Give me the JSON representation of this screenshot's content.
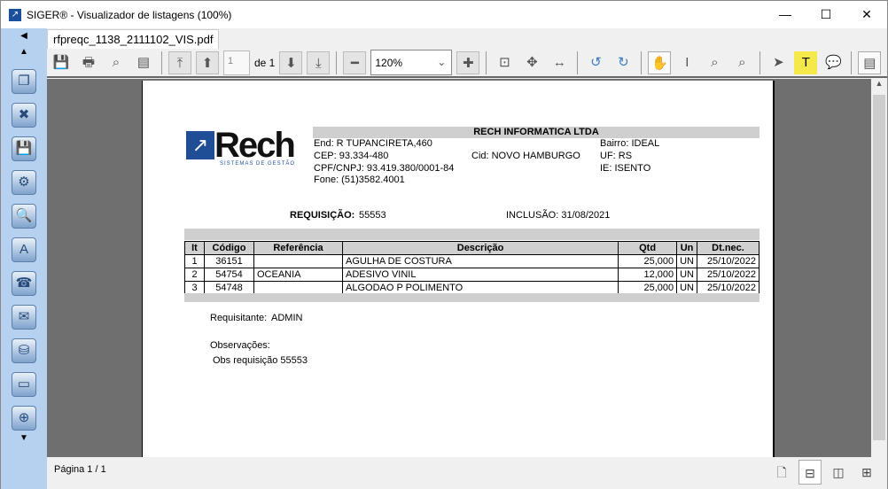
{
  "window": {
    "title": "SIGER® - Visualizador de listagens (100%)",
    "controls": [
      "minimize",
      "maximize",
      "close"
    ]
  },
  "sidebar": {
    "icons": [
      "copy-icon",
      "delete-file-icon",
      "save-icon",
      "settings-icon",
      "preview-icon",
      "pdf-icon",
      "fax-icon",
      "email-icon",
      "database-icon",
      "monitor-icon",
      "zoom-icon"
    ]
  },
  "tab": {
    "label": "rfpreqc_1138_2111102_VIS.pdf"
  },
  "toolbar": {
    "page_value": "1",
    "page_of": "de 1",
    "zoom": "120%"
  },
  "document": {
    "company": "RECH INFORMATICA LTDA",
    "logo_text": "Rech",
    "logo_sub": "SISTEMAS DE GESTÃO",
    "end": "End: R TUPANCIRETA,460",
    "cep": "CEP: 93.334-480",
    "cnpj": "CPF/CNPJ: 93.419.380/0001-84",
    "fone": "Fone: (51)3582.4001",
    "cid": "Cid: NOVO HAMBURGO",
    "bairro": "Bairro: IDEAL",
    "uf": "UF: RS",
    "ie": "IE: ISENTO",
    "req_label": "REQUISIÇÃO:",
    "req_value": "55553",
    "inclusao": "INCLUSÃO: 31/08/2021",
    "columns": [
      "It",
      "Código",
      "Referência",
      "Descrição",
      "Qtd",
      "Un",
      "Dt.nec."
    ],
    "rows": [
      [
        "1",
        "36151",
        "",
        "AGULHA DE COSTURA",
        "25,000",
        "UN",
        "25/10/2022"
      ],
      [
        "2",
        "54754",
        "OCEANIA",
        "ADESIVO VINIL",
        "12,000",
        "UN",
        "25/10/2022"
      ],
      [
        "3",
        "54748",
        "",
        "ALGODAO P POLIMENTO",
        "25,000",
        "UN",
        "25/10/2022"
      ]
    ],
    "requisitante_label": "Requisitante:",
    "requisitante": "ADMIN",
    "obs_label": "Observações:",
    "obs": "Obs requisição 55553"
  },
  "status": {
    "page": "Página 1 / 1"
  }
}
